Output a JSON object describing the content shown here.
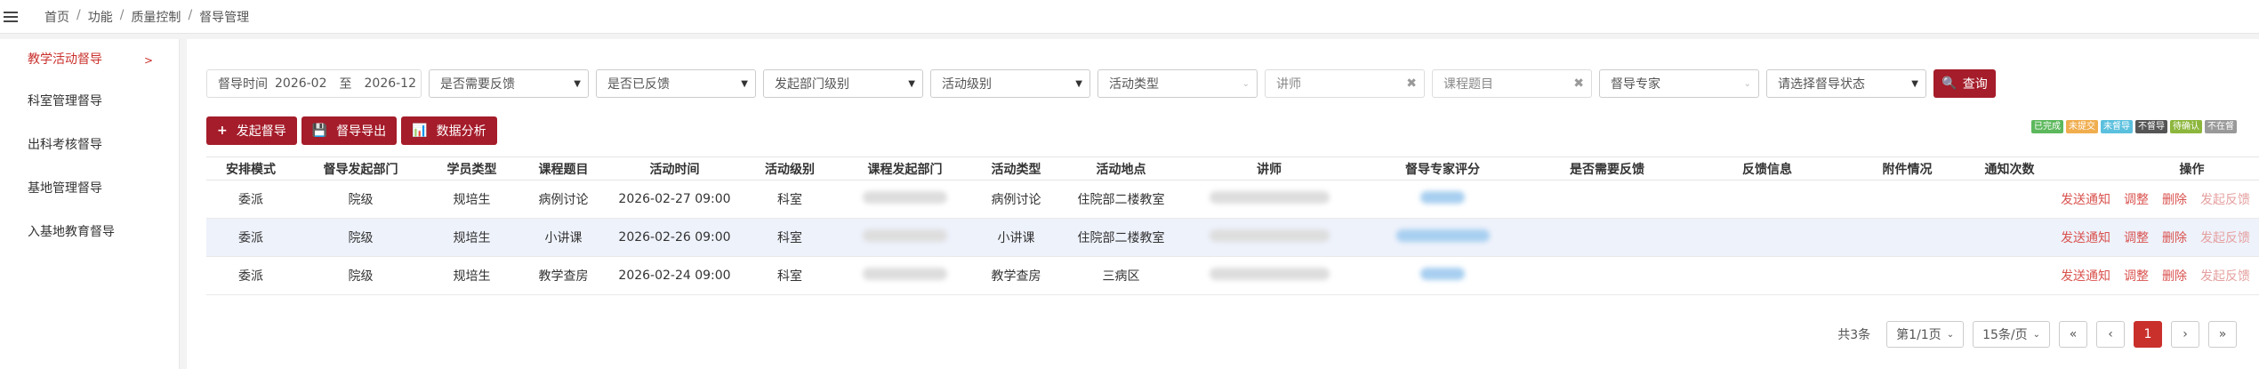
{
  "breadcrumb": [
    "首页",
    "功能",
    "质量控制",
    "督导管理"
  ],
  "sidebar": {
    "items": [
      {
        "label": "教学活动督导"
      },
      {
        "label": "科室管理督导"
      },
      {
        "label": "出科考核督导"
      },
      {
        "label": "基地管理督导"
      },
      {
        "label": "入基地教育督导"
      }
    ]
  },
  "filters": {
    "date_label": "督导时间",
    "date_from": "2026-02",
    "date_to_sep": "至",
    "date_to": "2026-12",
    "need_feedback": "是否需要反馈",
    "has_feedback": "是否已反馈",
    "dept_level": "发起部门级别",
    "activity_level": "活动级别",
    "activity_type": "活动类型",
    "teacher_placeholder": "讲师",
    "topic_placeholder": "课程题目",
    "expert": "督导专家",
    "status": "请选择督导状态",
    "query_label": "查询"
  },
  "actions": {
    "start": "发起督导",
    "export": "督导导出",
    "analysis": "数据分析"
  },
  "legend": [
    {
      "label": "已完成",
      "color": "#5cb85c"
    },
    {
      "label": "未提交",
      "color": "#f0ad4e"
    },
    {
      "label": "未督导",
      "color": "#5bc0de"
    },
    {
      "label": "不督导",
      "color": "#555555"
    },
    {
      "label": "待确认",
      "color": "#8cb63c"
    },
    {
      "label": "不在督",
      "color": "#999999"
    }
  ],
  "table": {
    "headers": [
      "安排模式",
      "督导发起部门",
      "学员类型",
      "课程题目",
      "活动时间",
      "活动级别",
      "课程发起部门",
      "活动类型",
      "活动地点",
      "讲师",
      "督导专家评分",
      "是否需要反馈",
      "反馈信息",
      "附件情况",
      "通知次数",
      "操作"
    ],
    "rows": [
      {
        "mode": "委派",
        "dept": "院级",
        "trainee": "规培生",
        "topic": "病例讨论",
        "time": "2026-02-27 09:00",
        "level": "科室",
        "type": "病例讨论",
        "place": "住院部二楼教室"
      },
      {
        "mode": "委派",
        "dept": "院级",
        "trainee": "规培生",
        "topic": "小讲课",
        "time": "2026-02-26 09:00",
        "level": "科室",
        "type": "小讲课",
        "place": "住院部二楼教室"
      },
      {
        "mode": "委派",
        "dept": "院级",
        "trainee": "规培生",
        "topic": "教学查房",
        "time": "2026-02-24 09:00",
        "level": "科室",
        "type": "教学查房",
        "place": "三病区"
      }
    ],
    "ops": [
      "发送通知",
      "调整",
      "删除",
      "发起反馈"
    ]
  },
  "pager": {
    "total": "共3条",
    "page": "第1/1页",
    "per_page": "15条/页",
    "first": "«",
    "prev": "‹",
    "current": "1",
    "next": "›",
    "last": "»"
  }
}
